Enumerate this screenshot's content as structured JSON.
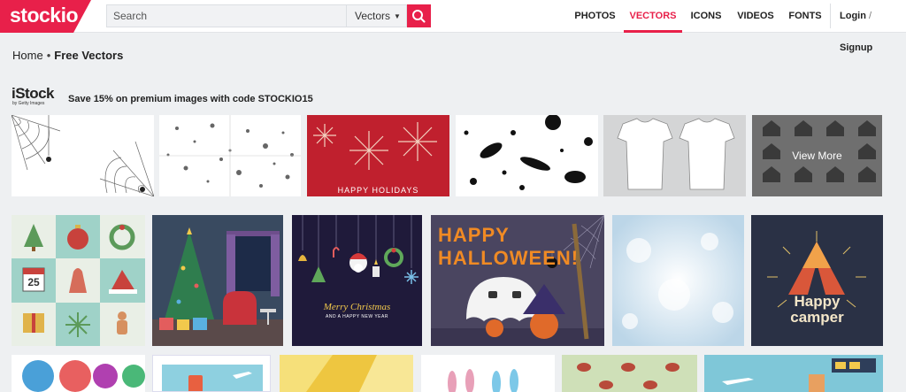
{
  "header": {
    "logo": "stockio",
    "search": {
      "placeholder": "Search",
      "category": "Vectors"
    },
    "nav": [
      "PHOTOS",
      "VECTORS",
      "ICONS",
      "VIDEOS",
      "FONTS"
    ],
    "active_nav": "VECTORS",
    "login": "Login",
    "signup": "Signup",
    "slash": "/"
  },
  "breadcrumb": {
    "home": "Home",
    "separator": "•",
    "current": "Free Vectors"
  },
  "promo": {
    "brand": "iStock",
    "brand_sub": "by Getty Images",
    "text": "Save 15% on premium images with code STOCKIO15",
    "view_more": "View More"
  },
  "gallery": {
    "holiday_label": "HAPPY HOLIDAYS",
    "calendar_number": "25",
    "halloween_line1": "HAPPY",
    "halloween_line2": "HALLOWEEN!",
    "christmas_line1": "Merry Christmas",
    "christmas_line2": "AND A HAPPY NEW YEAR",
    "camper_line1": "Happy",
    "camper_line2": "camper"
  },
  "colors": {
    "accent": "#e8204a",
    "background": "#eef0f2",
    "header": "#ffffff"
  }
}
